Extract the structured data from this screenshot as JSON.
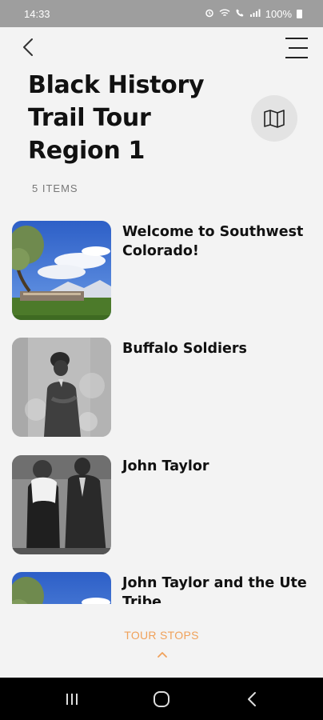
{
  "status_bar": {
    "time": "14:33",
    "icons": [
      "alarm-icon",
      "wifi-icon",
      "call-icon",
      "signal-icon"
    ],
    "battery": "100%"
  },
  "header": {
    "back_icon": "chevron-left-icon",
    "menu_icon": "hamburger-menu-icon"
  },
  "page": {
    "title": "Black History Trail Tour Region 1",
    "map_icon": "folded-map-icon",
    "item_count": "5 ITEMS"
  },
  "tour_items": [
    {
      "title": "Welcome to Southwest Colorado!",
      "image": "mountain-landscape-photo"
    },
    {
      "title": "Buffalo Soldiers",
      "image": "historic-soldier-portrait-photo"
    },
    {
      "title": "John Taylor",
      "image": "historic-couple-portrait-photo"
    },
    {
      "title": "John Taylor and the Ute Tribe",
      "image": "mountain-landscape-photo"
    }
  ],
  "footer": {
    "tour_stops_label": "TOUR STOPS",
    "chevron_icon": "chevron-up-icon"
  },
  "colors": {
    "accent": "#f0a15a",
    "background": "#f3f3f3",
    "status_bar": "#9e9e9e",
    "nav_bar": "#000000"
  },
  "system_nav": [
    "recents-button",
    "home-button",
    "back-button"
  ]
}
